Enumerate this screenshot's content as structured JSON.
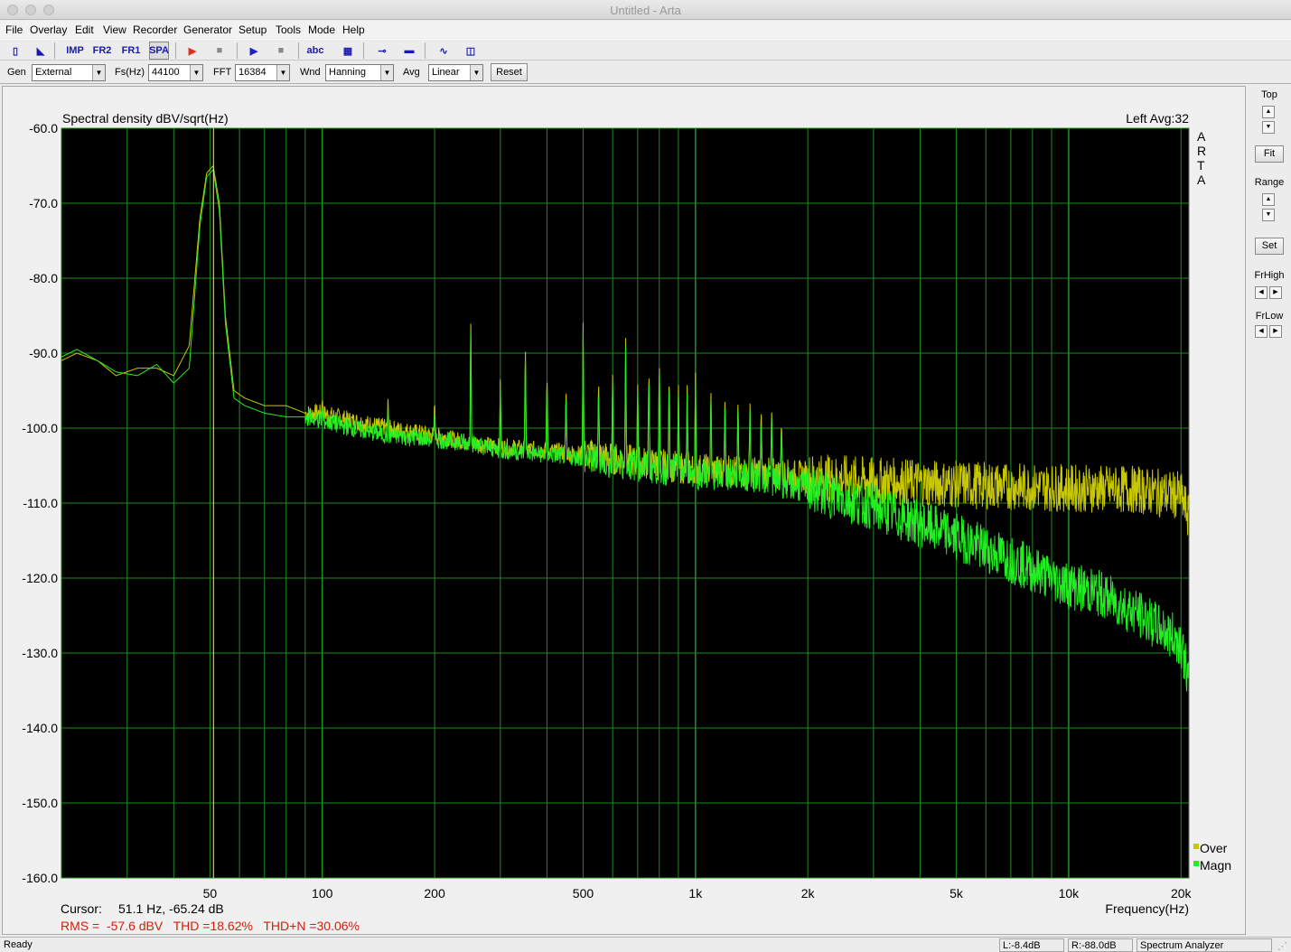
{
  "window": {
    "title": "Untitled - Arta"
  },
  "menu": [
    "File",
    "Overlay",
    "Edit",
    "View",
    "Recorder",
    "Generator",
    "Setup",
    "Tools",
    "Mode",
    "Help"
  ],
  "toolbar": {
    "buttons": [
      {
        "name": "new-file",
        "glyph": "▯"
      },
      {
        "name": "open-file",
        "glyph": "◣"
      },
      {
        "name": "impulse-mode",
        "glyph": "IMP"
      },
      {
        "name": "freq-response-2",
        "glyph": "FR2"
      },
      {
        "name": "freq-response-1",
        "glyph": "FR1"
      },
      {
        "name": "spectrum-analyzer",
        "glyph": "SPA",
        "active": true
      },
      {
        "name": "record",
        "glyph": "▶",
        "color": "#e03020"
      },
      {
        "name": "stop-record",
        "glyph": "■",
        "color": "#8a8a8a"
      },
      {
        "name": "play",
        "glyph": "▶",
        "color": "#2020c0"
      },
      {
        "name": "stop-play",
        "glyph": "■",
        "color": "#8a8a8a"
      },
      {
        "name": "calibrate-abc",
        "glyph": "abc"
      },
      {
        "name": "settings-gen",
        "glyph": "▦"
      },
      {
        "name": "settings-input",
        "glyph": "⊸"
      },
      {
        "name": "settings-output",
        "glyph": "▬"
      },
      {
        "name": "signal-wave",
        "glyph": "∿"
      },
      {
        "name": "scope-view",
        "glyph": "◫"
      }
    ]
  },
  "params": {
    "gen": {
      "label": "Gen",
      "value": "External"
    },
    "fs": {
      "label": "Fs(Hz)",
      "value": "44100"
    },
    "fft": {
      "label": "FFT",
      "value": "16384"
    },
    "wnd": {
      "label": "Wnd",
      "value": "Hanning"
    },
    "avg": {
      "label": "Avg",
      "value": "Linear"
    },
    "reset_label": "Reset"
  },
  "plot": {
    "ylabel": "Spectral density dBV/sqrt(Hz)",
    "channel_info": "Left  Avg:32",
    "brand": [
      "A",
      "R",
      "T",
      "A"
    ],
    "xlabel": "Frequency(Hz)",
    "legend": [
      {
        "name": "Over",
        "color": "#c8c800"
      },
      {
        "name": "Magn",
        "color": "#22ee22"
      }
    ],
    "cursor_label": "Cursor:",
    "cursor_value": "51.1 Hz, -65.24 dB",
    "stats": "RMS =  -57.6 dBV   THD =18.62%   THD+N =30.06%"
  },
  "chart_data": {
    "type": "line",
    "xscale": "log",
    "xlim": [
      20,
      21000
    ],
    "ylim": [
      -160,
      -60
    ],
    "grid": true,
    "ylabel": "Spectral density dBV/sqrt(Hz)",
    "xlabel": "Frequency(Hz)",
    "y_ticks": [
      "-60.0",
      "-70.0",
      "-80.0",
      "-90.0",
      "-100.0",
      "-110.0",
      "-120.0",
      "-130.0",
      "-140.0",
      "-150.0",
      "-160.0"
    ],
    "x_ticks": [
      {
        "value": 50,
        "label": "50"
      },
      {
        "value": 100,
        "label": "100"
      },
      {
        "value": 200,
        "label": "200"
      },
      {
        "value": 500,
        "label": "500"
      },
      {
        "value": 1000,
        "label": "1k"
      },
      {
        "value": 2000,
        "label": "2k"
      },
      {
        "value": 5000,
        "label": "5k"
      },
      {
        "value": 10000,
        "label": "10k"
      },
      {
        "value": 20000,
        "label": "20k"
      }
    ],
    "cursor_x": 51.1,
    "series": [
      {
        "name": "Over",
        "color": "#c8c800",
        "x": [
          20,
          22,
          25,
          28,
          32,
          36,
          40,
          44,
          47,
          49,
          51,
          53,
          55,
          58,
          62,
          70,
          80,
          90,
          100,
          120,
          150,
          200,
          250,
          300,
          400,
          500,
          700,
          1000,
          1500,
          2000,
          3000,
          5000,
          7000,
          10000,
          15000,
          20000,
          21000
        ],
        "y": [
          -91,
          -90,
          -91,
          -93,
          -92,
          -92,
          -93,
          -89,
          -72,
          -66,
          -65,
          -70,
          -85,
          -95,
          -96,
          -97,
          -97,
          -98,
          -98,
          -99,
          -100,
          -101,
          -102,
          -102.5,
          -103,
          -103.5,
          -104.5,
          -105.5,
          -106,
          -106.5,
          -107,
          -107.5,
          -107.8,
          -108,
          -108.2,
          -109,
          -112
        ]
      },
      {
        "name": "Magn",
        "color": "#22ee22",
        "x": [
          20,
          22,
          25,
          28,
          32,
          36,
          40,
          44,
          47,
          49,
          51,
          53,
          55,
          58,
          62,
          70,
          80,
          90,
          100,
          120,
          150,
          200,
          250,
          300,
          400,
          500,
          700,
          1000,
          1500,
          2000,
          3000,
          5000,
          7000,
          10000,
          12000,
          15000,
          20000,
          21000
        ],
        "y": [
          -90.5,
          -89.5,
          -91,
          -92.5,
          -93,
          -91.5,
          -94,
          -92,
          -73,
          -66.5,
          -65.5,
          -71,
          -86,
          -96,
          -97,
          -98,
          -98.5,
          -98.5,
          -99,
          -100,
          -101,
          -101.5,
          -102,
          -103,
          -103.5,
          -104,
          -105,
          -106,
          -106.5,
          -108,
          -110.5,
          -114.5,
          -117.5,
          -121,
          -122,
          -124.5,
          -128.5,
          -134
        ]
      }
    ],
    "harmonic_peaks": {
      "x": [
        100,
        150,
        200,
        250,
        300,
        350,
        400,
        450,
        500,
        550,
        600,
        650,
        700,
        750,
        800,
        850,
        900,
        950,
        1000,
        1100,
        1200,
        1300,
        1400,
        1500,
        1600,
        1700
      ],
      "y": [
        -97,
        -97,
        -97,
        -87,
        -94,
        -89,
        -93,
        -95,
        -86.5,
        -94,
        -93,
        -88,
        -94,
        -92,
        -91,
        -93,
        -94,
        -95,
        -93,
        -95,
        -96,
        -97,
        -97,
        -98,
        -98,
        -99
      ]
    }
  },
  "sidebar": {
    "top_label": "Top",
    "fit_label": "Fit",
    "range_label": "Range",
    "set_label": "Set",
    "frhigh_label": "FrHigh",
    "frlow_label": "FrLow"
  },
  "status": {
    "text": "Ready",
    "left_level": "L:-8.4dB",
    "right_level": "R:-88.0dB",
    "mode": "Spectrum Analyzer"
  }
}
